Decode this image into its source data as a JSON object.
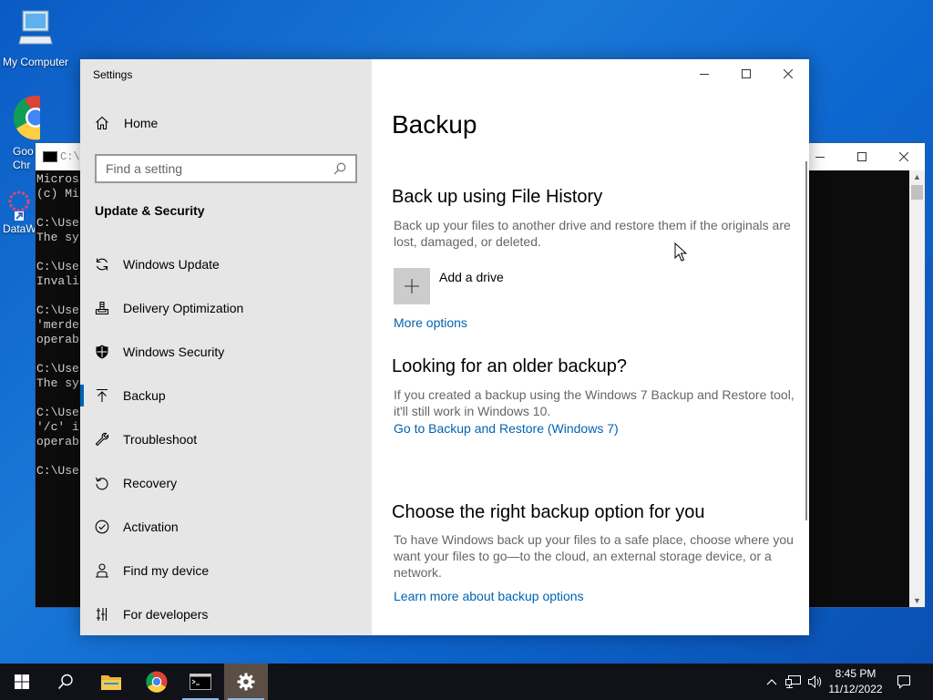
{
  "desktop": {
    "icons": [
      {
        "label": "My Computer"
      },
      {
        "label": "Goo Chr"
      },
      {
        "label": "DataW"
      }
    ]
  },
  "console": {
    "title": "C:\\",
    "lines": [
      "Micros",
      "(c) Mi",
      "",
      "C:\\Use",
      "The sy",
      "",
      "C:\\Use",
      "Invali",
      "",
      "C:\\Use",
      "'merde",
      "operab",
      "",
      "C:\\Use",
      "The sy",
      "",
      "C:\\Use",
      "'/c' i",
      "operab",
      "",
      "C:\\Use"
    ]
  },
  "settings": {
    "window_title": "Settings",
    "home_label": "Home",
    "search_placeholder": "Find a setting",
    "section_title": "Update & Security",
    "nav_items": [
      {
        "label": "Windows Update",
        "icon": "refresh-icon"
      },
      {
        "label": "Delivery Optimization",
        "icon": "delivery-icon"
      },
      {
        "label": "Windows Security",
        "icon": "shield-icon"
      },
      {
        "label": "Backup",
        "icon": "backup-arrow-icon",
        "active": true
      },
      {
        "label": "Troubleshoot",
        "icon": "wrench-icon"
      },
      {
        "label": "Recovery",
        "icon": "recovery-icon"
      },
      {
        "label": "Activation",
        "icon": "check-circle-icon"
      },
      {
        "label": "Find my device",
        "icon": "person-pin-icon"
      },
      {
        "label": "For developers",
        "icon": "developer-icon"
      }
    ],
    "content": {
      "page_title": "Backup",
      "file_history": {
        "heading": "Back up using File History",
        "desc": "Back up your files to another drive and restore them if the originals are lost, damaged, or deleted.",
        "add_drive": "Add a drive",
        "more_options": "More options"
      },
      "older_backup": {
        "heading": "Looking for an older backup?",
        "desc": "If you created a backup using the Windows 7 Backup and Restore tool, it'll still work in Windows 10.",
        "link": "Go to Backup and Restore (Windows 7)"
      },
      "right_option": {
        "heading": "Choose the right backup option for you",
        "desc": "To have Windows back up your files to a safe place, choose where you want your files to go—to the cloud, an external storage device, or a network.",
        "link": "Learn more about backup options"
      }
    }
  },
  "taskbar": {
    "time": "8:45 PM",
    "date": "11/12/2022"
  },
  "colors": {
    "accent": "#0063b1",
    "nav_bg": "#e6e6e6",
    "taskbar": "#101218"
  }
}
